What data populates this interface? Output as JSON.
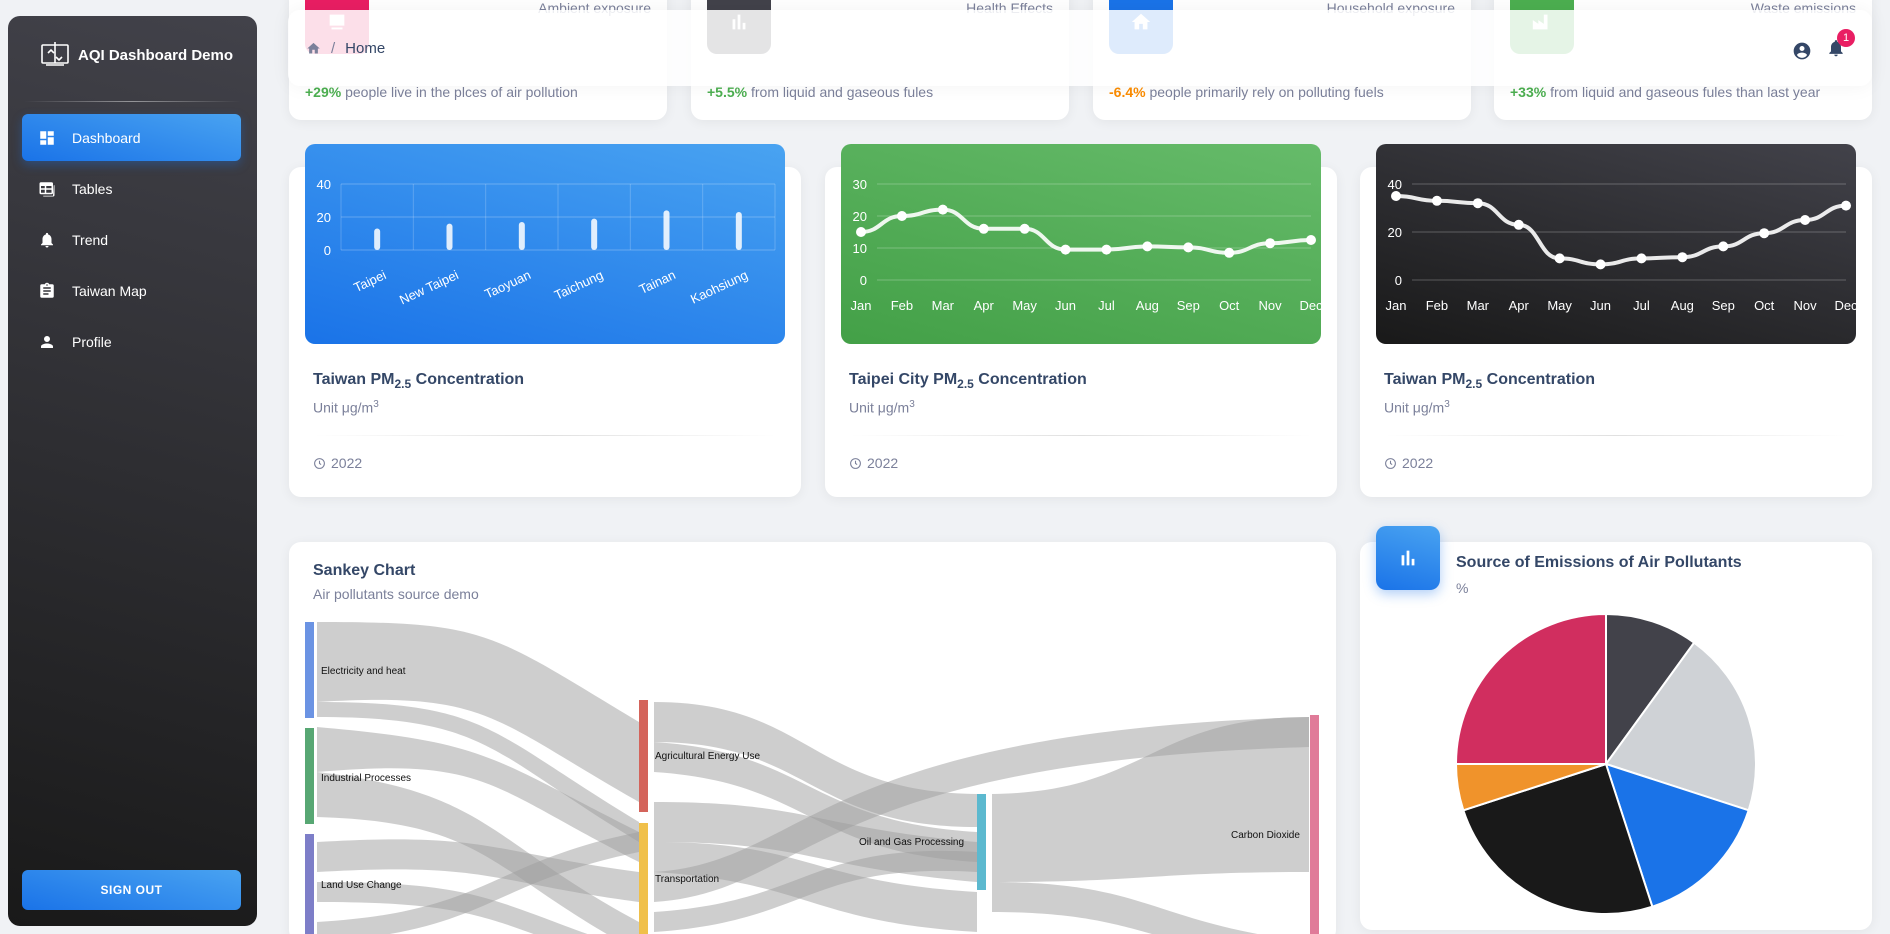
{
  "sidebar": {
    "brand": "AQI Dashboard Demo",
    "items": [
      {
        "label": "Dashboard",
        "icon": "dashboard-icon",
        "active": true
      },
      {
        "label": "Tables",
        "icon": "table-icon"
      },
      {
        "label": "Trend",
        "icon": "bell-icon"
      },
      {
        "label": "Taiwan Map",
        "icon": "clipboard-icon"
      },
      {
        "label": "Profile",
        "icon": "person-icon"
      }
    ],
    "signout": "SIGN OUT"
  },
  "topbar": {
    "breadcrumb": "Home",
    "separator": "/",
    "notification_count": "1"
  },
  "stats": [
    {
      "label": "Ambient exposure",
      "change": "+29%",
      "text": "people live in the plces of air pollution",
      "color": "#e91e63",
      "change_color": "#4CAF50",
      "icon": "chart-icon"
    },
    {
      "label": "Health Effects",
      "change": "+5.5%",
      "text": "from liquid and gaseous fules",
      "color": "#42424a",
      "change_color": "#4CAF50",
      "icon": "bar-icon"
    },
    {
      "label": "Household exposure",
      "change": "-6.4%",
      "text": "people primarily rely on polluting fuels",
      "color": "#1A73E8",
      "change_color": "#fb8c00",
      "icon": "home-icon"
    },
    {
      "label": "Waste emissions",
      "change": "+33%",
      "text": "from liquid and gaseous fules than last year",
      "color": "#4CAF50",
      "change_color": "#4CAF50",
      "icon": "factory-icon"
    }
  ],
  "cards": [
    {
      "title_pre": "Taiwan PM",
      "title_sub": "2.5",
      "title_post": " Concentration",
      "unit": "Unit μg/m",
      "unit_sup": "3",
      "year": "2022"
    },
    {
      "title_pre": "Taipei City PM",
      "title_sub": "2.5",
      "title_post": " Concentration",
      "unit": "Unit μg/m",
      "unit_sup": "3",
      "year": "2022"
    },
    {
      "title_pre": "Taiwan PM",
      "title_sub": "2.5",
      "title_post": " Concentration",
      "unit": "Unit μg/m",
      "unit_sup": "3",
      "year": "2022"
    }
  ],
  "chart_data": [
    {
      "type": "bar",
      "categories": [
        "Taipei",
        "New Taipei",
        "Taoyuan",
        "Taichung",
        "Tainan",
        "Kaohsiung"
      ],
      "values": [
        13,
        16,
        17,
        19,
        24,
        23
      ],
      "yticks": [
        0,
        20,
        40
      ],
      "ylim": [
        0,
        40
      ],
      "bg": [
        "#49a3f1",
        "#1A73E8"
      ]
    },
    {
      "type": "line",
      "categories": [
        "Jan",
        "Feb",
        "Mar",
        "Apr",
        "May",
        "Jun",
        "Jul",
        "Aug",
        "Sep",
        "Oct",
        "Nov",
        "Dec"
      ],
      "values": [
        15,
        20,
        22,
        16,
        16,
        9.5,
        9.5,
        10.5,
        10.2,
        8.5,
        11.5,
        12.5
      ],
      "yticks": [
        0,
        10,
        20,
        30
      ],
      "ylim": [
        0,
        30
      ],
      "bg": [
        "#66BB6A",
        "#43A047"
      ]
    },
    {
      "type": "line",
      "categories": [
        "Jan",
        "Feb",
        "Mar",
        "Apr",
        "May",
        "Jun",
        "Jul",
        "Aug",
        "Sep",
        "Oct",
        "Nov",
        "Dec"
      ],
      "values": [
        35,
        33,
        32,
        23,
        9,
        6.5,
        9,
        9.5,
        14,
        19.5,
        25,
        31
      ],
      "yticks": [
        0,
        20,
        40
      ],
      "ylim": [
        0,
        40
      ],
      "bg": [
        "#42424a",
        "#191919"
      ]
    },
    {
      "type": "pie",
      "title": "Source of Emissions of Air Pollutants",
      "subtitle": "%",
      "values": [
        10,
        20,
        15,
        25,
        5,
        25
      ],
      "colors": [
        "#42424a",
        "#cfd2d6",
        "#1A73E8",
        "#191919",
        "#f0932b",
        "#d12e5f"
      ]
    }
  ],
  "sankey": {
    "title": "Sankey Chart",
    "subtitle": "Air pollutants source demo",
    "nodes": [
      {
        "name": "Electricity and heat",
        "color": "#6b93e3"
      },
      {
        "name": "Industrial Processes",
        "color": "#57a773"
      },
      {
        "name": "Land Use Change",
        "color": "#7d7ec8"
      },
      {
        "name": "Agricultural Energy Use",
        "color": "#d4645b"
      },
      {
        "name": "Transportation",
        "color": "#f0c04a"
      },
      {
        "name": "Oil and Gas Processing",
        "color": "#5cb9cf"
      },
      {
        "name": "Carbon Dioxide",
        "color": "#e07b99"
      }
    ]
  }
}
